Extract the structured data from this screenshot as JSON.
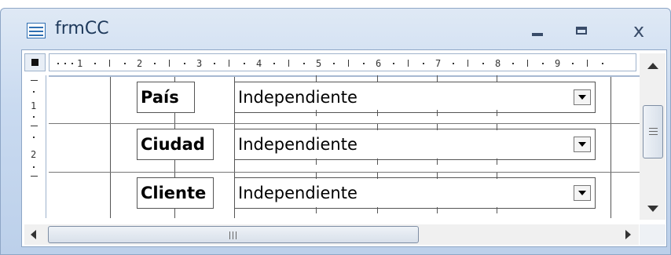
{
  "window": {
    "title": "frmCC",
    "icon": "form-icon",
    "minimize": "minimize-icon",
    "maximize": "maximize-icon",
    "close_glyph": "x"
  },
  "ruler": {
    "horizontal": [
      "1",
      "2",
      "3",
      "4",
      "5",
      "6",
      "7",
      "8",
      "9"
    ],
    "vertical": [
      "1",
      "2"
    ]
  },
  "rows": [
    {
      "label": "País",
      "value": "Independiente"
    },
    {
      "label": "Ciudad",
      "value": "Independiente"
    },
    {
      "label": "Cliente",
      "value": "Independiente"
    }
  ],
  "colors": {
    "frame": "#c9daf0",
    "title_text": "#1e395b",
    "grid_lines": "#555555"
  }
}
